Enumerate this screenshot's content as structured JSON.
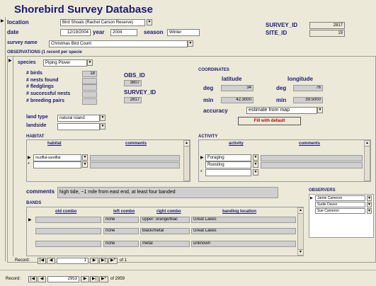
{
  "title": "Shorebird Survey Database",
  "main": {
    "location": {
      "label": "location",
      "value": "Bird Shoals (Rachel Carson Reserve)"
    },
    "date": {
      "label": "date",
      "value": "12/19/2004"
    },
    "year": {
      "label": "year",
      "value": "2004"
    },
    "season": {
      "label": "season",
      "value": "Winter"
    },
    "survey_id": {
      "label": "SURVEY_ID",
      "value": "2817"
    },
    "site_id": {
      "label": "SITE_ID",
      "value": "19"
    },
    "survey_name": {
      "label": "survey name",
      "value": "Christmas Bird Count"
    }
  },
  "obs": {
    "heading": "OBSERVATIONS (1 record per specie",
    "species": {
      "label": "species",
      "value": "Piping Plover"
    },
    "birds": {
      "label": "# birds",
      "value": "18"
    },
    "nests": {
      "label": "# nests found",
      "value": ""
    },
    "fledglings": {
      "label": "# fledglings",
      "value": ""
    },
    "successful": {
      "label": "# successful nests",
      "value": ""
    },
    "breeding": {
      "label": "# breeding pairs",
      "value": ""
    },
    "obs_id": {
      "label": "OBS_ID",
      "value": "3807"
    },
    "survey_id": {
      "label": "SURVEY_ID",
      "value": "2817"
    },
    "land_type": {
      "label": "land type",
      "value": "natural island"
    },
    "landside": {
      "label": "landside",
      "value": ""
    }
  },
  "coords": {
    "heading": "COORDINATES",
    "latitude_label": "latitude",
    "longitude_label": "longitude",
    "deg_label": "deg",
    "min_label": "min",
    "lat_deg": "34",
    "lat_min": "42.3000",
    "lon_deg": "76",
    "lon_min": "39.5000",
    "accuracy_label": "accuracy",
    "accuracy_value": "estimate from map",
    "fill_button": "Fill with default"
  },
  "habitat": {
    "heading": "HABITAT",
    "col_habitat": "habitat",
    "col_comments": "comments",
    "rows": [
      {
        "habitat": "mudflat-sandflat",
        "comments": ""
      }
    ]
  },
  "activity": {
    "heading": "ACTIVITY",
    "col_activity": "activity",
    "col_comments": "comments",
    "rows": [
      {
        "activity": "Foraging",
        "comments": ""
      },
      {
        "activity": "Roosting",
        "comments": ""
      }
    ]
  },
  "comments": {
    "label": "comments",
    "value": "high tide, ~1 mile from east end, at least four banded"
  },
  "observers": {
    "heading": "OBSERVERS",
    "rows": [
      "Jamie Cameron",
      "Sudie Davez",
      "Sue Cameron"
    ]
  },
  "bands": {
    "heading": "BANDS",
    "col_old": "old combo",
    "col_left": "left combo",
    "col_right": "right combo",
    "col_loc": "banding location",
    "rows": [
      {
        "old": "",
        "left": "none",
        "right": "upper: orange/blac",
        "loc": "Great Lakes"
      },
      {
        "old": "",
        "left": "none",
        "right": "black/metal",
        "loc": "Great Lakes"
      },
      {
        "old": "",
        "left": "none",
        "right": "metal",
        "loc": "unknown"
      }
    ]
  },
  "nav_inner": {
    "label": "Record:",
    "current": "1",
    "of": "of 1"
  },
  "nav_outer": {
    "label": "Record:",
    "current": "2953",
    "of": "of 2959"
  },
  "icons": {
    "first": "|◀",
    "prev": "◀",
    "next": "▶",
    "last": "▶|",
    "new": "▶*",
    "dropdown": "▼",
    "selector": "▶",
    "newrow": "*",
    "scroll_up": "▲",
    "scroll_down": "▼"
  }
}
